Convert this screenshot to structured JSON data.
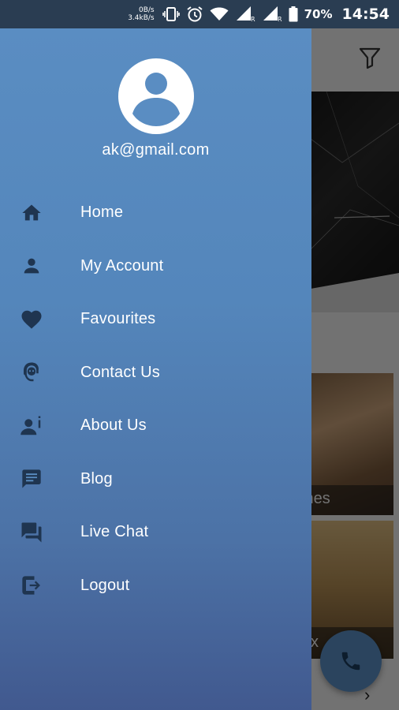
{
  "status_bar": {
    "net_speed_up": "0B/s",
    "net_speed_down": "3.4kB/s",
    "battery": "70%",
    "time": "14:54",
    "icons": [
      "vibrate-icon",
      "alarm-icon",
      "wifi-icon",
      "signal-icon",
      "signal-icon",
      "battery-icon"
    ]
  },
  "drawer": {
    "user_email": "ak@gmail.com",
    "items": [
      {
        "label": "Home",
        "icon": "home-icon"
      },
      {
        "label": "My Account",
        "icon": "person-icon"
      },
      {
        "label": "Favourites",
        "icon": "heart-icon"
      },
      {
        "label": "Contact Us",
        "icon": "support-agent-icon"
      },
      {
        "label": "About Us",
        "icon": "person-info-icon"
      },
      {
        "label": "Blog",
        "icon": "message-icon"
      },
      {
        "label": "Live Chat",
        "icon": "chat-icon"
      },
      {
        "label": "Logout",
        "icon": "logout-icon"
      }
    ]
  },
  "background": {
    "card1_caption": "ines",
    "card2_caption": "x"
  },
  "colors": {
    "drawer_top": "#5a8dc2",
    "drawer_bottom": "#41598f",
    "icon": "#1f3550",
    "fab": "#5b8fc4"
  }
}
